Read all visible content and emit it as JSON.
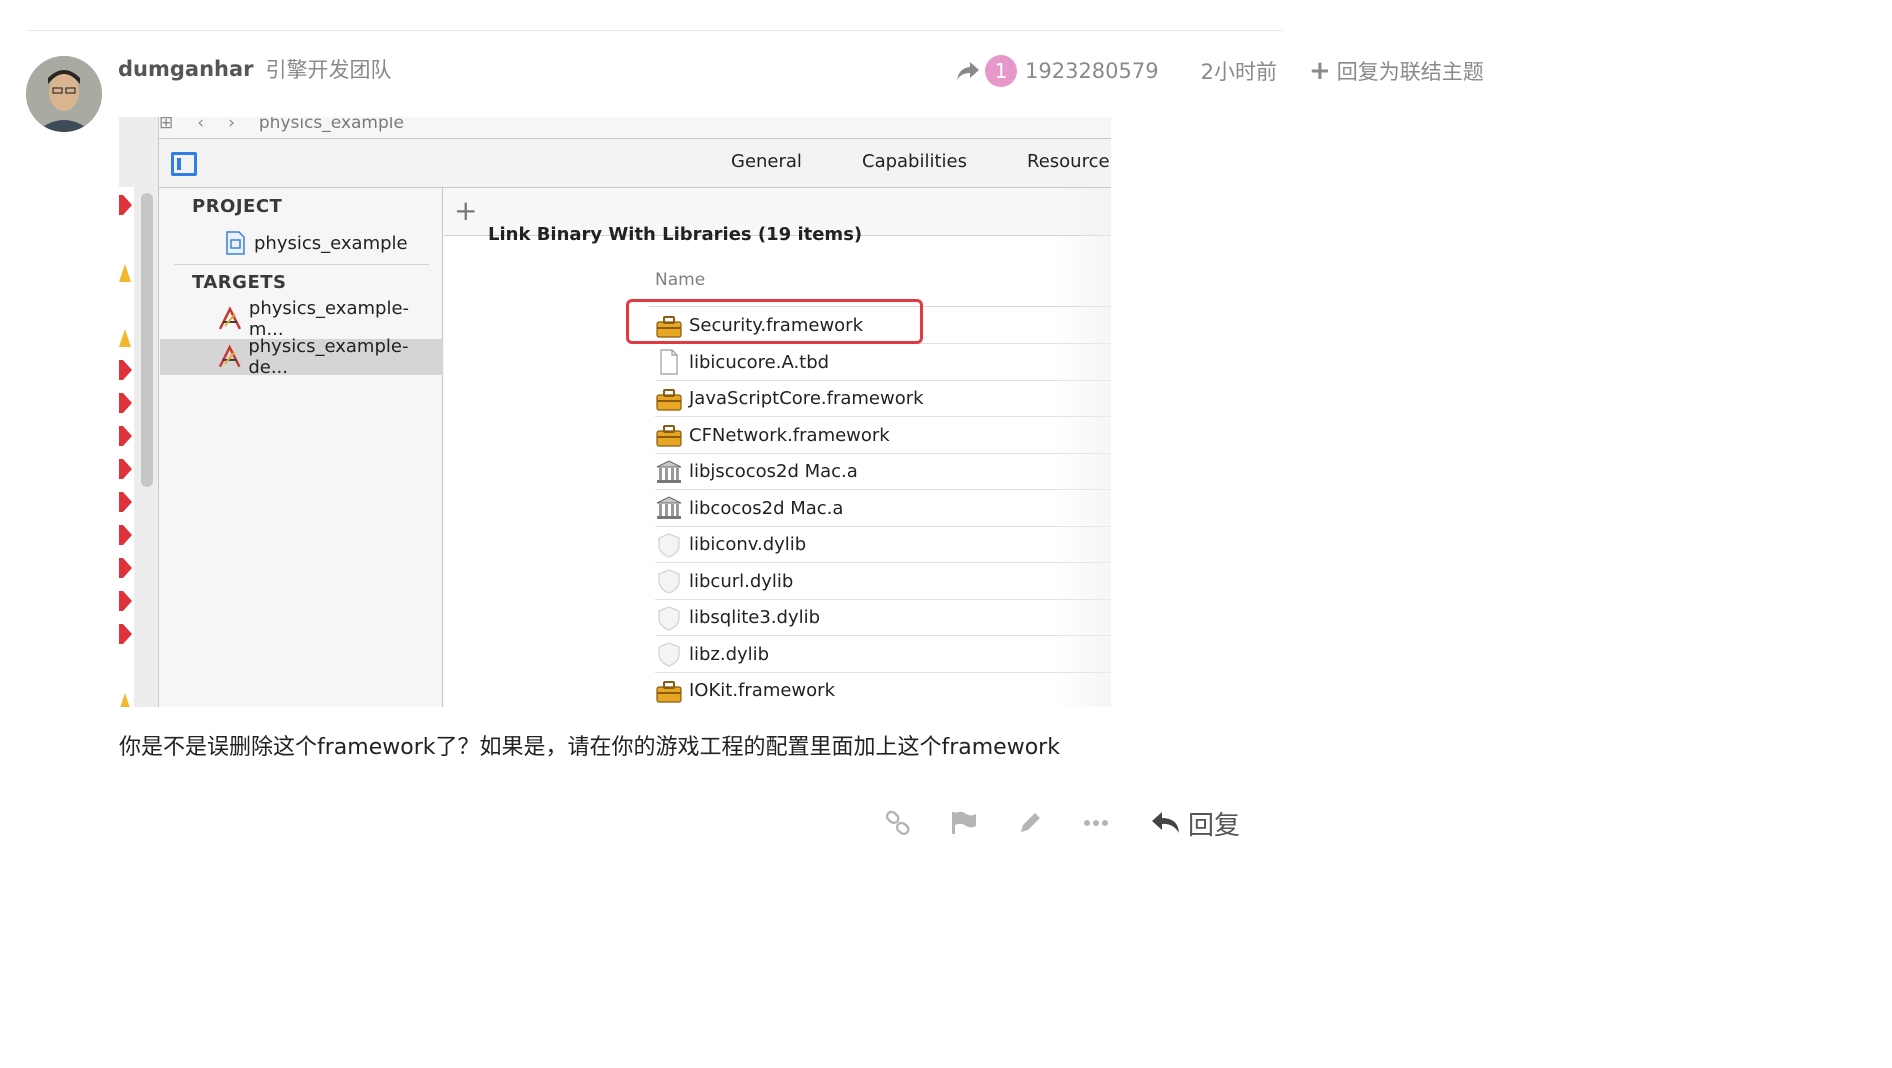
{
  "post": {
    "username": "dumganhar",
    "user_title": "引擎开发团队",
    "reply_count": "1",
    "reply_to_user": "1923280579",
    "date": "2小时前",
    "link_topic_label": "回复为联结主题",
    "body": "你是不是误删除这个framework了？如果是，请在你的游戏工程的配置里面加上这个framework",
    "reply_label": "回复"
  },
  "screenshot": {
    "breadcrumb": "physics_example",
    "tabs": [
      "General",
      "Capabilities",
      "Resource"
    ],
    "project_header": "PROJECT",
    "project_item": "physics_example",
    "targets_header": "TARGETS",
    "targets": [
      "physics_example-m...",
      "physics_example-de..."
    ],
    "phase_title": "Link Binary With Libraries (19 items)",
    "column_name": "Name",
    "libraries": [
      {
        "name": "Security.framework",
        "icon": "toolbox-icon"
      },
      {
        "name": "libicucore.A.tbd",
        "icon": "document-icon"
      },
      {
        "name": "JavaScriptCore.framework",
        "icon": "toolbox-icon"
      },
      {
        "name": "CFNetwork.framework",
        "icon": "toolbox-icon"
      },
      {
        "name": "libjscocos2d Mac.a",
        "icon": "library-building-icon"
      },
      {
        "name": "libcocos2d Mac.a",
        "icon": "library-building-icon"
      },
      {
        "name": "libiconv.dylib",
        "icon": "shield-icon"
      },
      {
        "name": "libcurl.dylib",
        "icon": "shield-icon"
      },
      {
        "name": "libsqlite3.dylib",
        "icon": "shield-icon"
      },
      {
        "name": "libz.dylib",
        "icon": "shield-icon"
      },
      {
        "name": "IOKit.framework",
        "icon": "toolbox-icon"
      }
    ],
    "highlight_color": "#e23a44"
  },
  "colors": {
    "badge": "#e598c9",
    "meta_text": "#8a8a8a"
  }
}
